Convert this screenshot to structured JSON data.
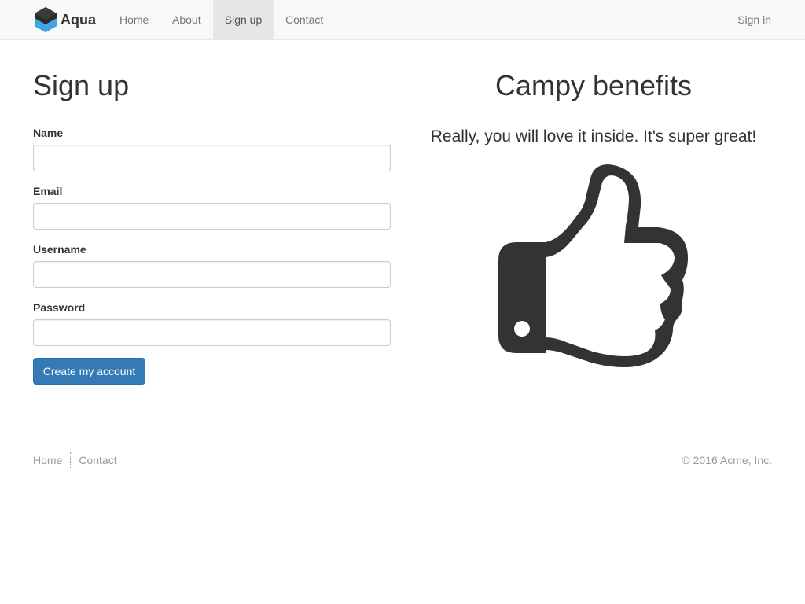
{
  "navbar": {
    "brand": "Aqua",
    "links": [
      {
        "label": "Home"
      },
      {
        "label": "About"
      },
      {
        "label": "Sign up"
      },
      {
        "label": "Contact"
      }
    ],
    "signin": "Sign in"
  },
  "signup": {
    "title": "Sign up",
    "fields": {
      "name": {
        "label": "Name",
        "value": ""
      },
      "email": {
        "label": "Email",
        "value": ""
      },
      "username": {
        "label": "Username",
        "value": ""
      },
      "password": {
        "label": "Password",
        "value": ""
      }
    },
    "submit": "Create my account"
  },
  "benefits": {
    "title": "Campy benefits",
    "lead": "Really, you will love it inside. It's super great!",
    "icon": "thumbs-up-icon"
  },
  "footer": {
    "links": [
      {
        "label": "Home"
      },
      {
        "label": "Contact"
      }
    ],
    "copyright": "© 2016 Acme, Inc."
  },
  "colors": {
    "navbar_bg": "#f8f8f8",
    "active_tab": "#e7e7e7",
    "primary": "#337ab7",
    "text": "#333333",
    "muted": "#999999",
    "logo_blue": "#3ea7e2"
  }
}
